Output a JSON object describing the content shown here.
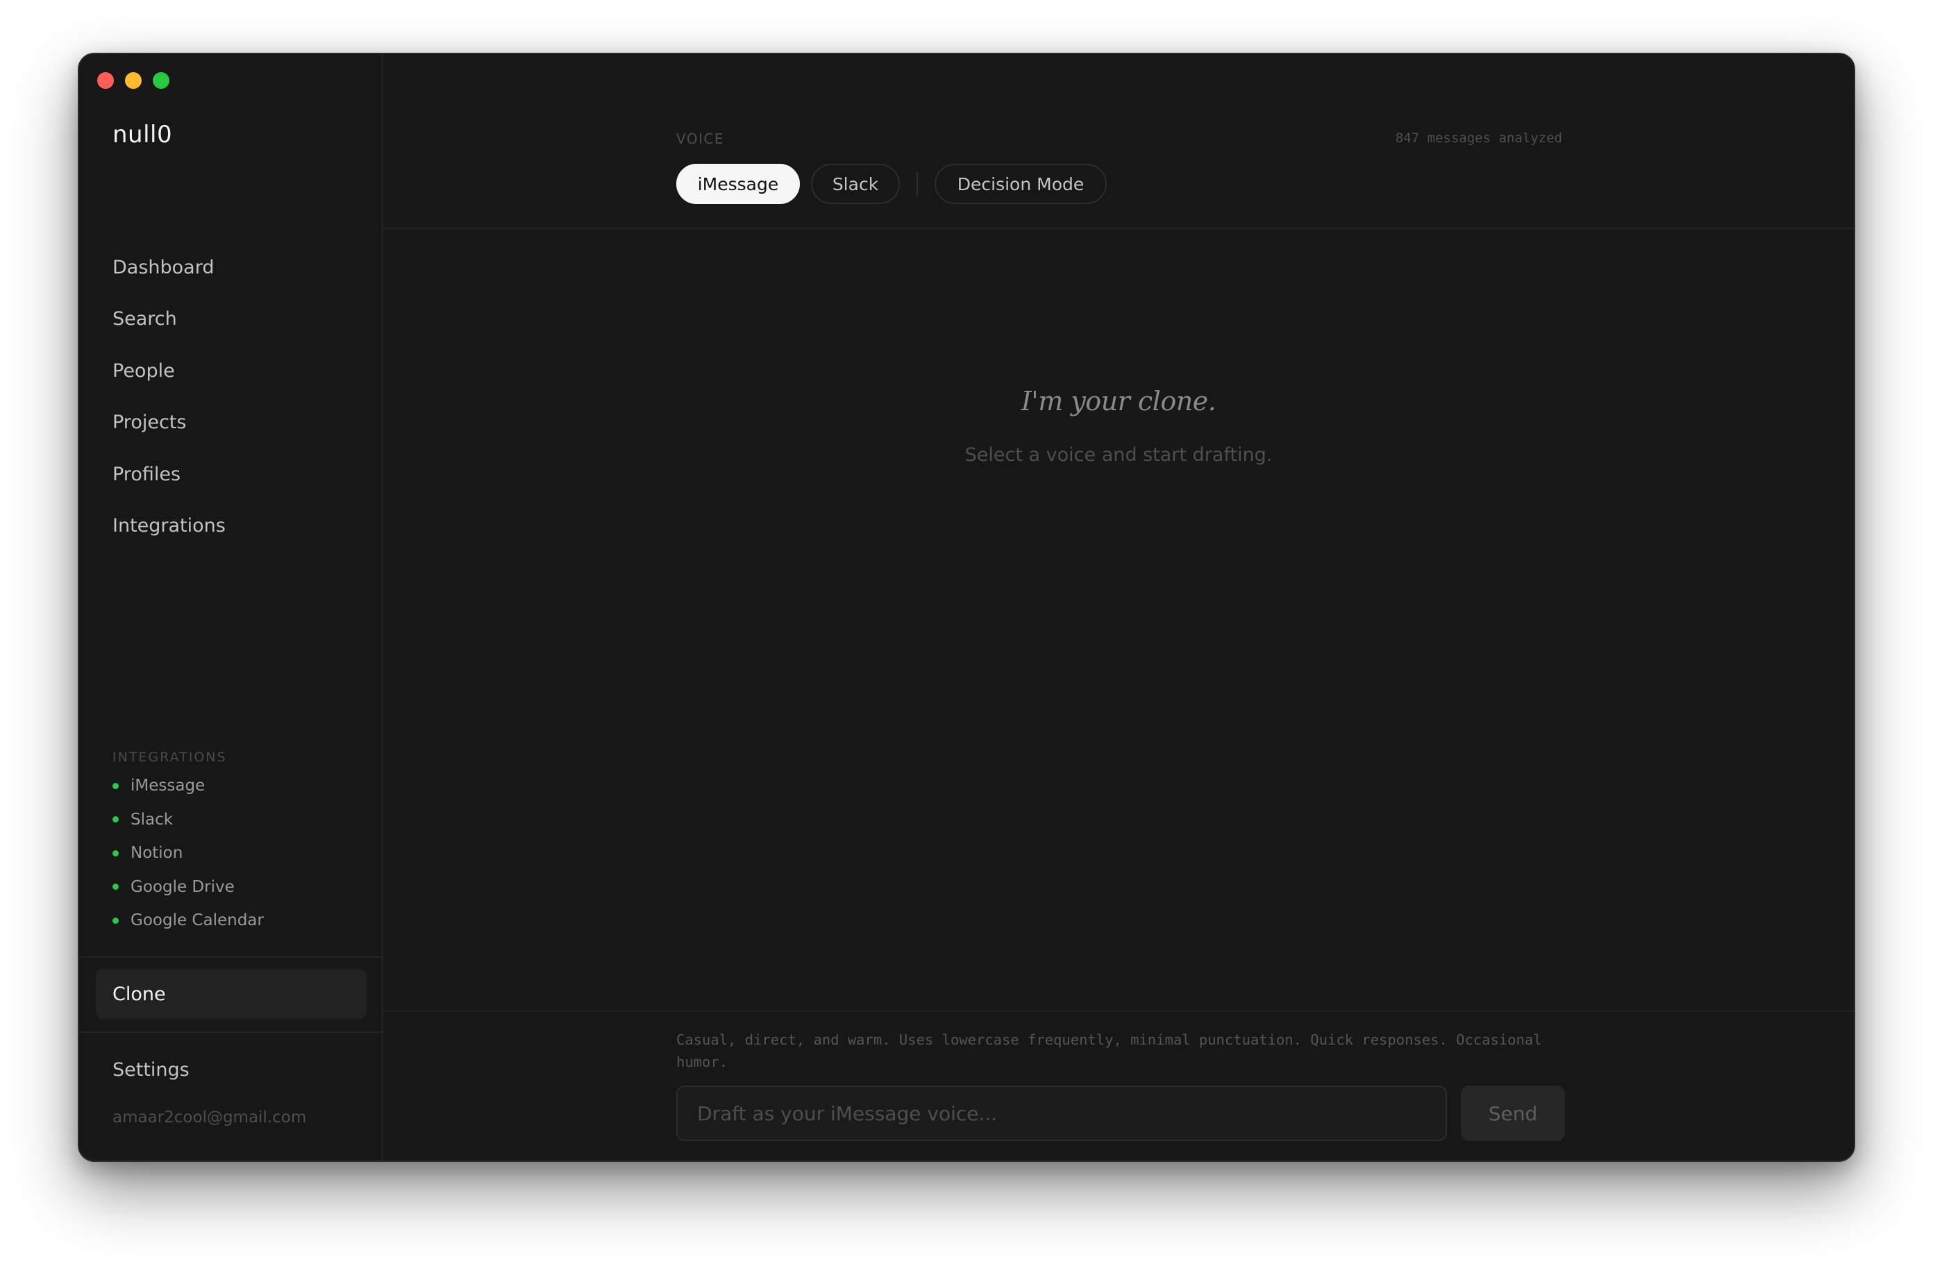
{
  "app": {
    "logo": "null0"
  },
  "sidebar": {
    "nav": [
      {
        "label": "Dashboard"
      },
      {
        "label": "Search"
      },
      {
        "label": "People"
      },
      {
        "label": "Projects"
      },
      {
        "label": "Profiles"
      },
      {
        "label": "Integrations"
      }
    ],
    "integrations_header": "INTEGRATIONS",
    "integrations": [
      {
        "label": "iMessage",
        "status": "connected"
      },
      {
        "label": "Slack",
        "status": "connected"
      },
      {
        "label": "Notion",
        "status": "connected"
      },
      {
        "label": "Google Drive",
        "status": "connected"
      },
      {
        "label": "Google Calendar",
        "status": "connected"
      }
    ],
    "active_item": "Clone",
    "settings": "Settings",
    "user_email": "amaar2cool@gmail.com"
  },
  "main": {
    "voice_label": "VOICE",
    "messages_analyzed": "847 messages analyzed",
    "tabs": [
      {
        "label": "iMessage",
        "active": true
      },
      {
        "label": "Slack",
        "active": false
      },
      {
        "label": "Decision Mode",
        "active": false
      }
    ],
    "empty_state": {
      "title": "I'm your clone.",
      "subtitle": "Select a voice and start drafting."
    },
    "voice_description": "Casual, direct, and warm. Uses lowercase frequently, minimal punctuation. Quick responses. Occasional humor.",
    "draft_placeholder": "Draft as your iMessage voice...",
    "send_label": "Send"
  },
  "colors": {
    "window_bg": "#171717",
    "status_green": "#29c94a",
    "active_pill_bg": "#f6f6f6",
    "traffic_red": "#ff5f57",
    "traffic_yellow": "#febc2e",
    "traffic_green": "#28c840"
  }
}
